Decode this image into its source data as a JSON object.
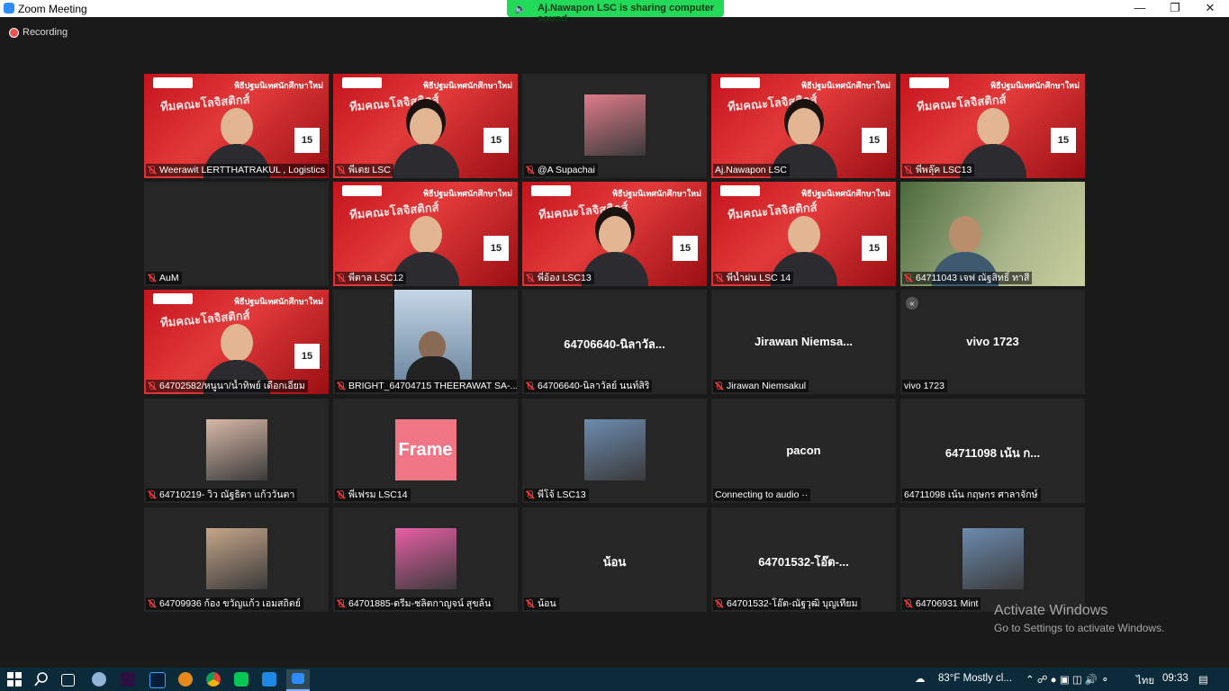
{
  "window": {
    "title": "Zoom Meeting",
    "sharing_banner": "Aj.Nawapon LSC is sharing computer sound",
    "recording_label": "Recording"
  },
  "participants": [
    {
      "name": "Weerawit LERTTHATRAKUL , Logistics ...",
      "muted": true,
      "video": "banner"
    },
    {
      "name": "พี่เตย LSC",
      "muted": true,
      "video": "banner"
    },
    {
      "name": "@A Supachai",
      "muted": true,
      "video": "thumb"
    },
    {
      "name": "Aj.Nawapon LSC",
      "muted": false,
      "video": "banner",
      "active": true
    },
    {
      "name": "พี่พลุ๊ค LSC13",
      "muted": true,
      "video": "banner"
    },
    {
      "name": "AuM",
      "muted": true,
      "video": "none"
    },
    {
      "name": "พี่ตาล LSC12",
      "muted": true,
      "video": "banner"
    },
    {
      "name": "พี่อ้อง LSC13",
      "muted": true,
      "video": "banner"
    },
    {
      "name": "พี่น้ำฝน LSC 14",
      "muted": true,
      "video": "banner"
    },
    {
      "name": "64711043 เจฟ ณัฐสิทธิ์ ทาสี",
      "muted": true,
      "video": "camera"
    },
    {
      "name": "64702582/หนูนา/น้ำทิพย์ เดือกเอี่ยม",
      "muted": true,
      "video": "banner"
    },
    {
      "name": "BRIGHT_64704715 THEERAWAT SA-...",
      "muted": true,
      "video": "camera-small"
    },
    {
      "name": "64706640-นิลาวัลย์ นนท์สิริ",
      "muted": true,
      "video": "text",
      "display": "64706640-นิลาวัล..."
    },
    {
      "name": "Jirawan Niemsakul",
      "muted": true,
      "video": "text",
      "display": "Jirawan  Niemsa..."
    },
    {
      "name": "vivo 1723",
      "muted": false,
      "video": "text",
      "display": "vivo 1723",
      "rewind": true
    },
    {
      "name": "64710219- วิว ณัฐธิดา   แก้ววันตา",
      "muted": true,
      "video": "thumb"
    },
    {
      "name": "พี่เฟรม LSC14",
      "muted": true,
      "video": "thumb-frame",
      "thumb_text": "Frame"
    },
    {
      "name": "พี่โจ้  LSC13",
      "muted": true,
      "video": "thumb"
    },
    {
      "name": "Connecting to audio ··",
      "muted": false,
      "video": "text",
      "display": "pacon"
    },
    {
      "name": "64711098 เน้น กฤษกร ศาลาจักษ์",
      "muted": false,
      "video": "text",
      "display": "64711098 เน้น ก..."
    },
    {
      "name": "64709936 ก้อง ขวัญแก้ว เอมสถิตย์",
      "muted": true,
      "video": "thumb"
    },
    {
      "name": "64701885-ดรีม-ชลิตกาญจน์ สุขล้น",
      "muted": true,
      "video": "thumb"
    },
    {
      "name": "น้อน",
      "muted": true,
      "video": "text",
      "display": "น้อน"
    },
    {
      "name": "64701532-โอ๊ต-ณัฐวุฒิ บุญเทียม",
      "muted": true,
      "video": "text",
      "display": "64701532-โอ๊ต-..."
    },
    {
      "name": "64706931 Mint",
      "muted": true,
      "video": "thumb"
    }
  ],
  "banner_text": {
    "title": "พิธีปฐมนิเทศนักศึกษาใหม่",
    "subtitle": "ทีมคณะโลจิสติกส์",
    "date": "15"
  },
  "activation": {
    "line1": "Activate Windows",
    "line2": "Go to Settings to activate Windows."
  },
  "taskbar": {
    "weather": "83°F  Mostly cl...",
    "lang": "ไทย",
    "time": "09:33"
  },
  "colors": {
    "active_border": "#d8d32a",
    "banner_red": "#c4141d",
    "share_green": "#23d959"
  }
}
